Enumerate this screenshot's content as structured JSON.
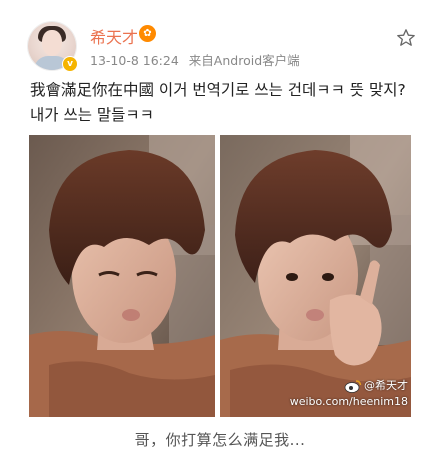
{
  "post": {
    "username": "希天才",
    "vip_badge": "✿",
    "verified_mark": "v",
    "time": "13-10-8 16:24",
    "source": "来自Android客户端",
    "text": "我會滿足你在中國  이거 번역기로 쓰는 건데ㅋㅋ 뜻 맞지? 내가 쓰는 말들ㅋㅋ",
    "favorite_icon": "star-outline-icon",
    "watermark_handle": "@希天才",
    "watermark_url": "weibo.com/heenim18"
  },
  "caption": "哥，你打算怎么满足我...",
  "colors": {
    "username": "#eb7350",
    "meta": "#888888",
    "text": "#222222",
    "caption": "#555555",
    "verified": "#f5b400"
  }
}
